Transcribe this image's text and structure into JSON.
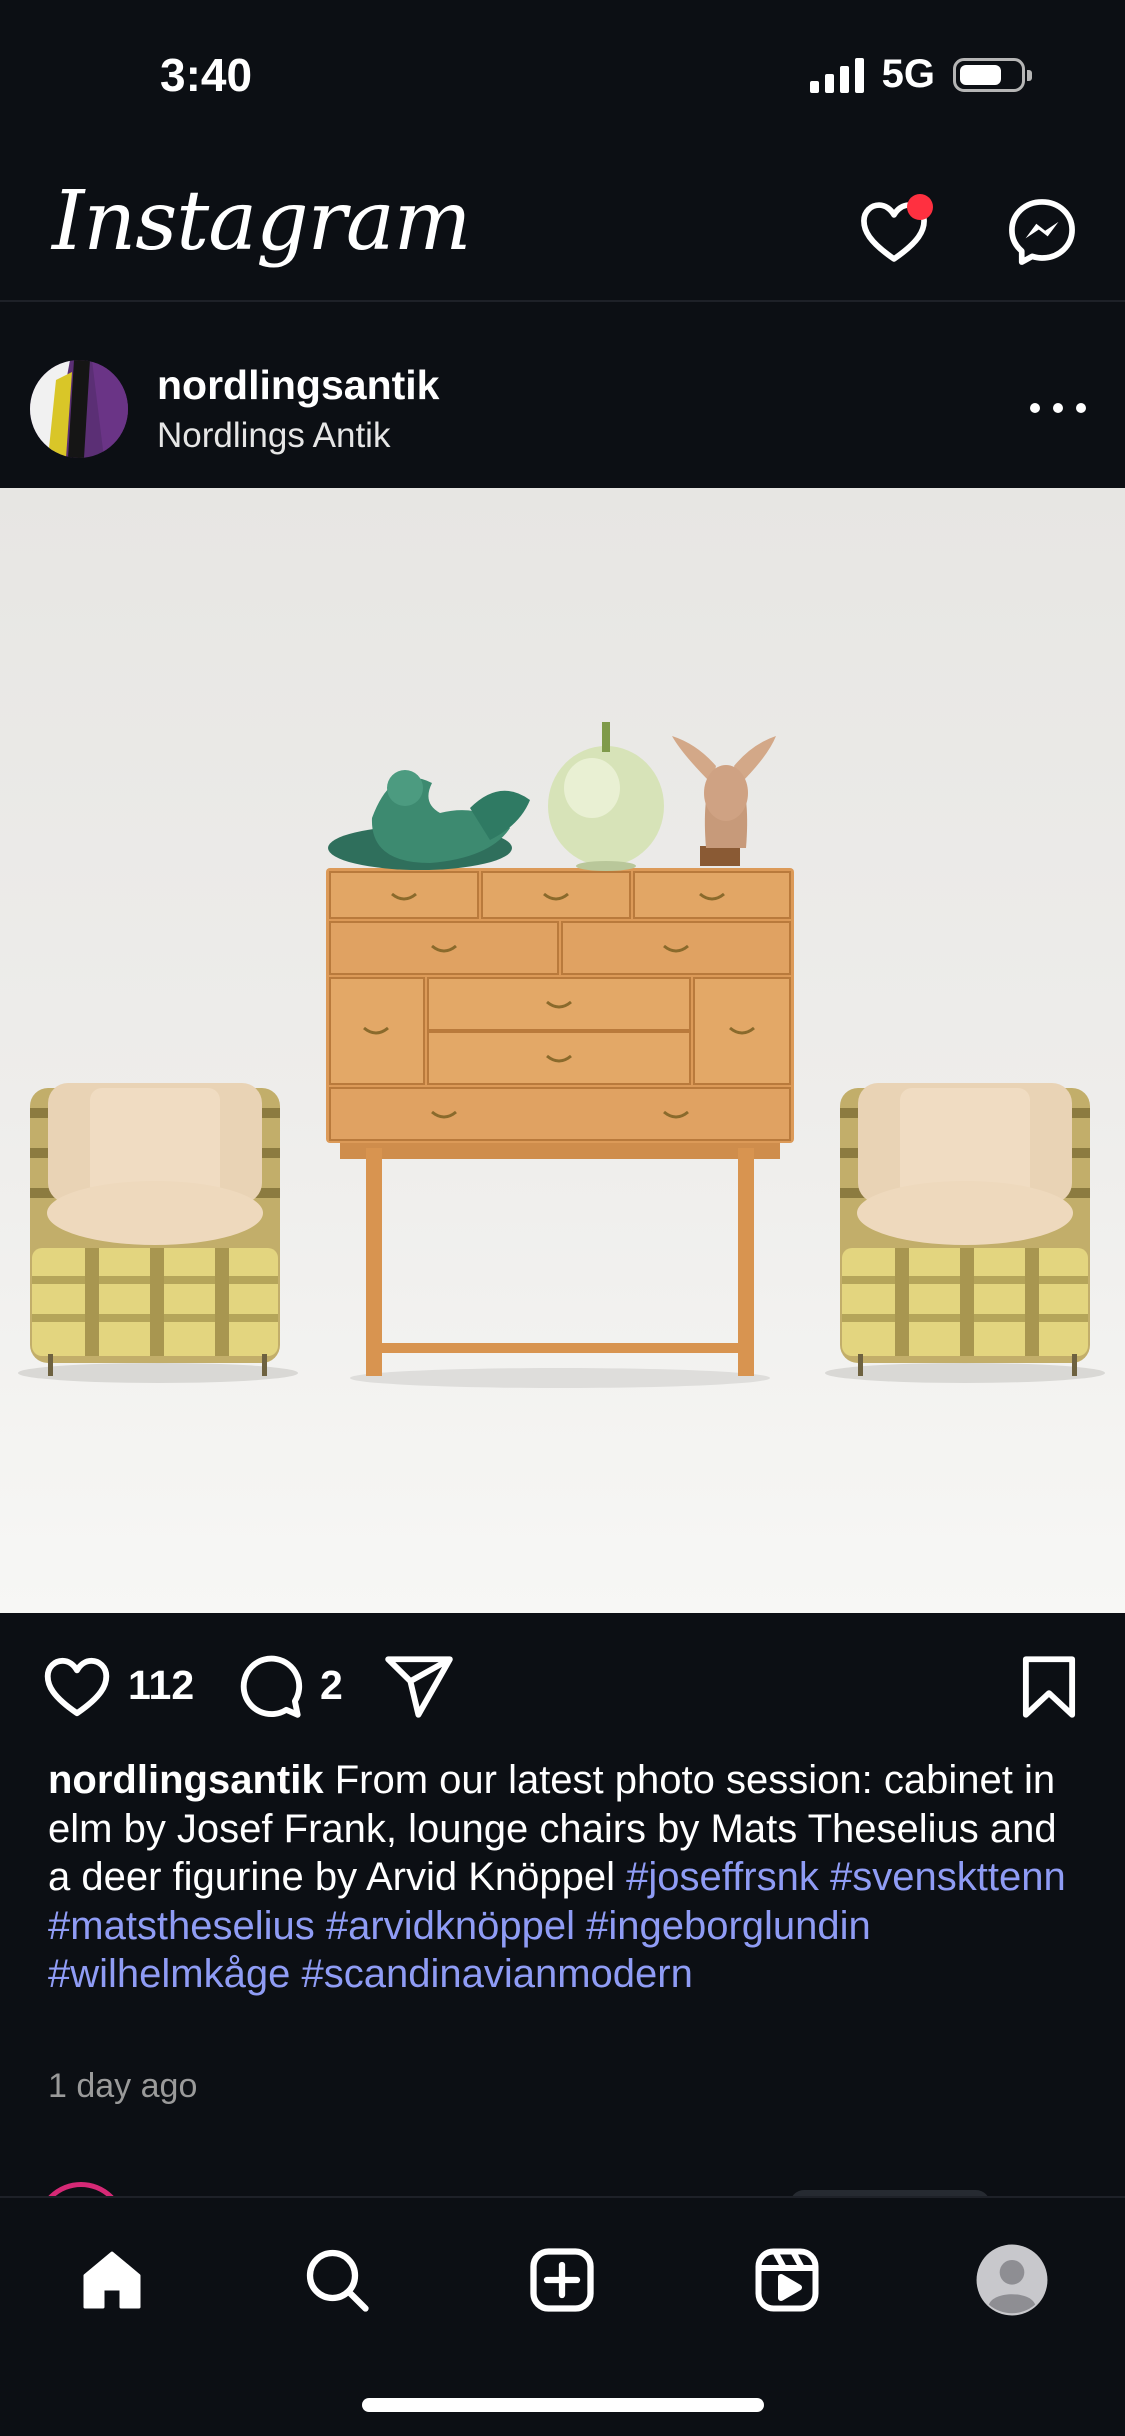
{
  "status_bar": {
    "time": "3:40",
    "network": "5G",
    "battery_level": 0.7
  },
  "header": {
    "app_name": "Instagram",
    "icons": [
      "heart-icon",
      "messenger-icon"
    ],
    "notification_dot_color": "#ff3040"
  },
  "post": {
    "username": "nordlingsantik",
    "location": "Nordlings Antik",
    "like_count": "112",
    "comment_count": "2",
    "caption": {
      "username": "nordlingsantik",
      "text": "From our latest photo session: cabinet in elm by Josef Frank, lounge chairs by Mats Theselius and a deer figurine by Arvid Knöppel",
      "hashtags": [
        "#joseffrsnk",
        "#svenskttenn",
        "#matstheselius",
        "#arvidknöppel",
        "#ingeborglundin",
        "#wilhelmkåge",
        "#scandinavianmodern"
      ]
    },
    "timestamp": "1 day ago"
  },
  "colors": {
    "background": "#0c0f14",
    "hashtag": "#8f9cf5",
    "story_ring": "#d62976"
  },
  "bottom_nav": {
    "items": [
      "home-icon",
      "search-icon",
      "create-icon",
      "reels-icon",
      "profile-icon"
    ],
    "active": "home-icon"
  }
}
